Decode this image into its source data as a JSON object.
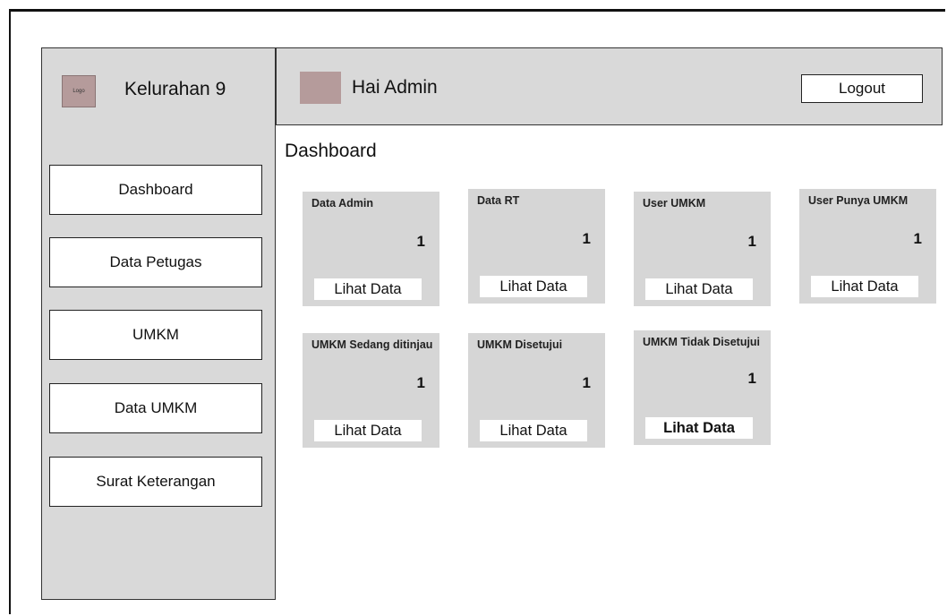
{
  "brand": {
    "logo_text": "Logo",
    "name": "Kelurahan 9"
  },
  "header": {
    "greeting": "Hai Admin",
    "logout_label": "Logout"
  },
  "sidebar": {
    "items": [
      {
        "label": "Dashboard"
      },
      {
        "label": "Data Petugas"
      },
      {
        "label": "UMKM"
      },
      {
        "label": "Data UMKM"
      },
      {
        "label": "Surat Keterangan"
      }
    ]
  },
  "main": {
    "title": "Dashboard",
    "cards": [
      {
        "title": "Data Admin",
        "value": "1",
        "button": "Lihat Data"
      },
      {
        "title": "Data RT",
        "value": "1",
        "button": "Lihat Data"
      },
      {
        "title": "User UMKM",
        "value": "1",
        "button": "Lihat Data"
      },
      {
        "title": "User Punya UMKM",
        "value": "1",
        "button": "Lihat Data"
      },
      {
        "title": "UMKM Sedang ditinjau",
        "value": "1",
        "button": "Lihat Data"
      },
      {
        "title": "UMKM Disetujui",
        "value": "1",
        "button": "Lihat Data"
      },
      {
        "title": "UMKM Tidak Disetujui",
        "value": "1",
        "button": "Lihat Data"
      }
    ]
  },
  "colors": {
    "panel": "#d9d9d9",
    "placeholder": "#b59b9b",
    "button_bg": "#ffffff"
  }
}
